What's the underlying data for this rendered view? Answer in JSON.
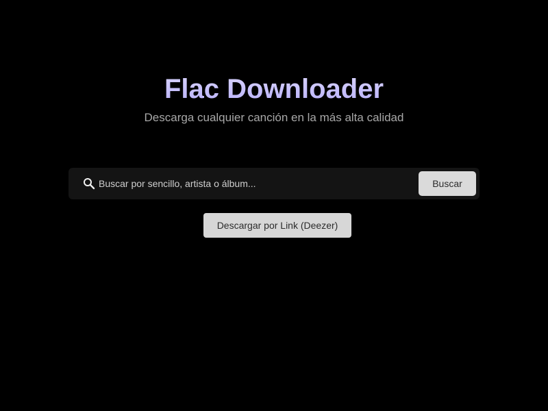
{
  "header": {
    "title": "Flac Downloader",
    "subtitle": "Descarga cualquier canción en la más alta calidad"
  },
  "search": {
    "icon": "search-icon",
    "placeholder": "Buscar por sencillo, artista o álbum...",
    "value": "",
    "button_label": "Buscar"
  },
  "actions": {
    "link_download_label": "Descargar por Link (Deezer)"
  },
  "colors": {
    "background": "#000000",
    "title_accent": "#c9c3ff",
    "search_bar_bg": "#141414",
    "button_bg": "#dadada"
  }
}
